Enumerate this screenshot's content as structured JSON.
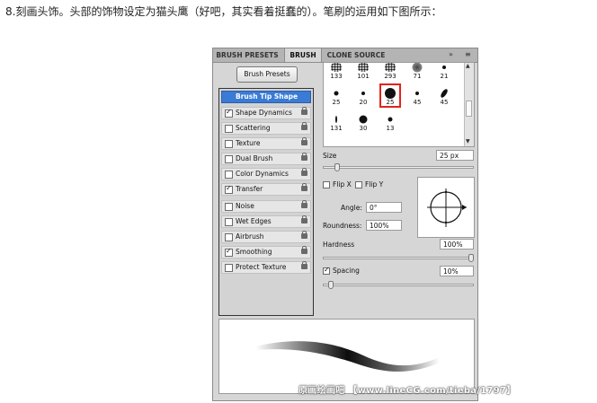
{
  "caption": "8.刻画头饰。头部的饰物设定为猫头鹰（好吧，其实看着挺蠢的）。笔刷的运用如下图所示：",
  "tabs": [
    {
      "label": "BRUSH PRESETS",
      "active": false
    },
    {
      "label": "BRUSH",
      "active": true
    },
    {
      "label": "CLONE SOURCE",
      "active": false
    }
  ],
  "tab_menu_icons": [
    "double-arrow-icon",
    "panel-menu-icon"
  ],
  "brush_presets_button": "Brush Presets",
  "options": [
    {
      "label": "Brush Tip Shape",
      "checked": null,
      "selected": true,
      "lock": false
    },
    {
      "label": "Shape Dynamics",
      "checked": true,
      "lock": true
    },
    {
      "label": "Scattering",
      "checked": false,
      "lock": true
    },
    {
      "label": "Texture",
      "checked": false,
      "lock": true
    },
    {
      "label": "Dual Brush",
      "checked": false,
      "lock": true
    },
    {
      "label": "Color Dynamics",
      "checked": false,
      "lock": true
    },
    {
      "label": "Transfer",
      "checked": true,
      "lock": true
    },
    {
      "label": "Noise",
      "checked": false,
      "lock": true
    },
    {
      "label": "Wet Edges",
      "checked": false,
      "lock": true
    },
    {
      "label": "Airbrush",
      "checked": false,
      "lock": true
    },
    {
      "label": "Smoothing",
      "checked": true,
      "lock": true
    },
    {
      "label": "Protect Texture",
      "checked": false,
      "lock": true
    }
  ],
  "tips": [
    {
      "size": "133",
      "shape": "spatter"
    },
    {
      "size": "101",
      "shape": "spatter"
    },
    {
      "size": "293",
      "shape": "spatter"
    },
    {
      "size": "71",
      "shape": "textured"
    },
    {
      "size": "21",
      "shape": "round"
    },
    {
      "size": "25",
      "shape": "round"
    },
    {
      "size": "20",
      "shape": "round"
    },
    {
      "size": "25",
      "shape": "round",
      "selected": true
    },
    {
      "size": "45",
      "shape": "round"
    },
    {
      "size": "45",
      "shape": "leaf"
    },
    {
      "size": "131",
      "shape": "thin"
    },
    {
      "size": "30",
      "shape": "round"
    },
    {
      "size": "13",
      "shape": "round"
    }
  ],
  "size": {
    "label": "Size",
    "value": "25 px",
    "slider_fraction": 0.08
  },
  "flip_x": {
    "label": "Flip X",
    "checked": false
  },
  "flip_y": {
    "label": "Flip Y",
    "checked": false
  },
  "angle": {
    "label": "Angle:",
    "value": "0°"
  },
  "roundness": {
    "label": "Roundness:",
    "value": "100%"
  },
  "hardness": {
    "label": "Hardness",
    "value": "100%",
    "slider_fraction": 1.0
  },
  "spacing": {
    "label": "Spacing",
    "value": "10%",
    "checked": true,
    "slider_fraction": 0.04
  },
  "watermark": "原画绘画吧 【www.lineCG.com/tieba/1797】"
}
